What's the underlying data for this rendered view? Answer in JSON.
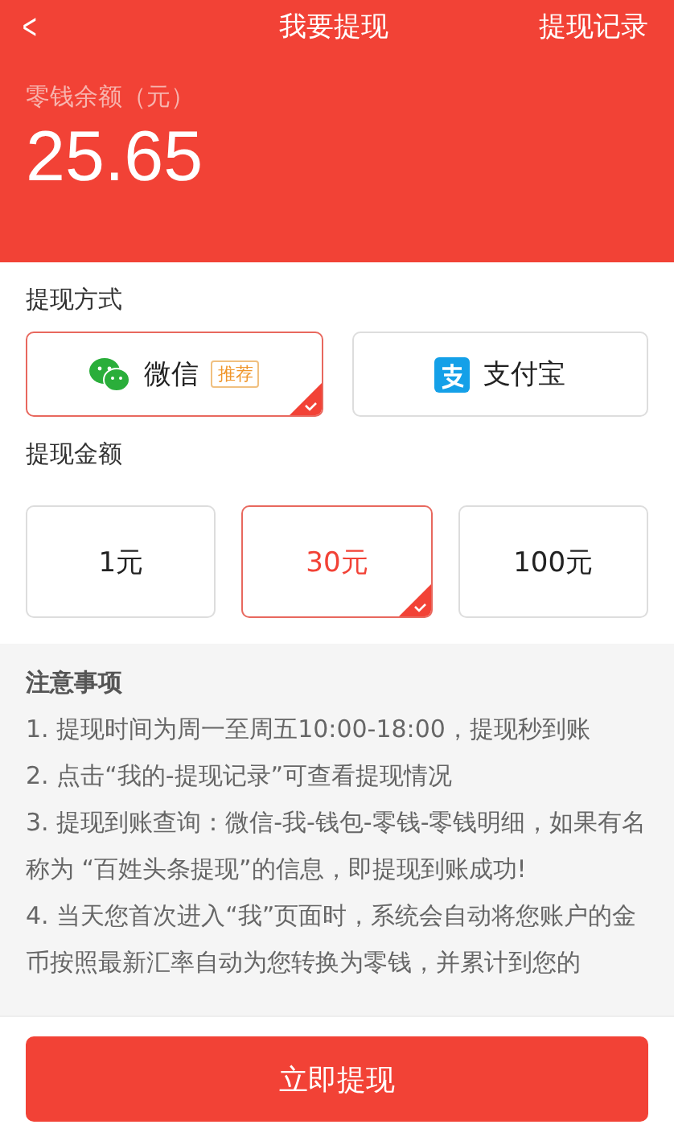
{
  "nav": {
    "back": "<",
    "title": "我要提现",
    "action": "提现记录"
  },
  "balance": {
    "label": "零钱余额（元）",
    "amount": "25.65"
  },
  "methods": {
    "title": "提现方式",
    "items": [
      {
        "kind": "wechat",
        "label": "微信",
        "badge": "推荐",
        "selected": true
      },
      {
        "kind": "alipay",
        "label": "支付宝",
        "selected": false
      }
    ]
  },
  "amounts": {
    "title": "提现金额",
    "items": [
      {
        "label": "1元",
        "selected": false
      },
      {
        "label": "30元",
        "selected": true
      },
      {
        "label": "100元",
        "selected": false
      }
    ]
  },
  "notes": {
    "title": "注意事项",
    "items": [
      "1. 提现时间为周一至周五10:00-18:00，提现秒到账",
      "2. 点击“我的-提现记录”可查看提现情况",
      "3. 提现到账查询：微信-我-钱包-零钱-零钱明细，如果有名称为 “百姓头条提现”的信息，即提现到账成功!",
      "4. 当天您首次进入“我”页面时，系统会自动将您账户的金币按照最新汇率自动为您转换为零钱，并累计到您的"
    ]
  },
  "submit": "立即提现"
}
